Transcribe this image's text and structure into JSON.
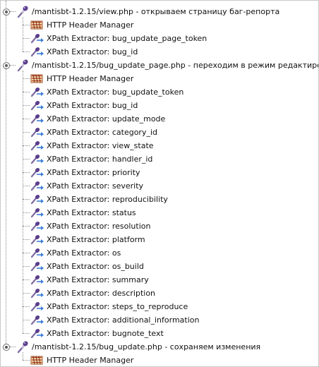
{
  "tree": {
    "groups": [
      {
        "sampler": "/mantisbt-1.2.15/view.php - открываем страницу баг-репорта",
        "children": [
          {
            "icon": "header-manager-icon",
            "label": "HTTP Header Manager"
          },
          {
            "icon": "xpath-extractor-icon",
            "label": "XPath Extractor: bug_update_page_token"
          },
          {
            "icon": "xpath-extractor-icon",
            "label": "XPath Extractor: bug_id"
          }
        ]
      },
      {
        "sampler": "/mantisbt-1.2.15/bug_update_page.php - переходим в режим редактирования",
        "children": [
          {
            "icon": "header-manager-icon",
            "label": "HTTP Header Manager"
          },
          {
            "icon": "xpath-extractor-icon",
            "label": "XPath Extractor: bug_update_token"
          },
          {
            "icon": "xpath-extractor-icon",
            "label": "XPath Extractor: bug_id"
          },
          {
            "icon": "xpath-extractor-icon",
            "label": "XPath Extractor: update_mode"
          },
          {
            "icon": "xpath-extractor-icon",
            "label": "XPath Extractor: category_id"
          },
          {
            "icon": "xpath-extractor-icon",
            "label": "XPath Extractor: view_state"
          },
          {
            "icon": "xpath-extractor-icon",
            "label": "XPath Extractor: handler_id"
          },
          {
            "icon": "xpath-extractor-icon",
            "label": "XPath Extractor: priority"
          },
          {
            "icon": "xpath-extractor-icon",
            "label": "XPath Extractor: severity"
          },
          {
            "icon": "xpath-extractor-icon",
            "label": "XPath Extractor: reproducibility"
          },
          {
            "icon": "xpath-extractor-icon",
            "label": "XPath Extractor: status"
          },
          {
            "icon": "xpath-extractor-icon",
            "label": "XPath Extractor: resolution"
          },
          {
            "icon": "xpath-extractor-icon",
            "label": "XPath Extractor: platform"
          },
          {
            "icon": "xpath-extractor-icon",
            "label": "XPath Extractor: os"
          },
          {
            "icon": "xpath-extractor-icon",
            "label": "XPath Extractor: os_build"
          },
          {
            "icon": "xpath-extractor-icon",
            "label": "XPath Extractor: summary"
          },
          {
            "icon": "xpath-extractor-icon",
            "label": "XPath Extractor: description"
          },
          {
            "icon": "xpath-extractor-icon",
            "label": "XPath Extractor: steps_to_reproduce"
          },
          {
            "icon": "xpath-extractor-icon",
            "label": "XPath Extractor: additional_information"
          },
          {
            "icon": "xpath-extractor-icon",
            "label": "XPath Extractor: bugnote_text"
          }
        ]
      },
      {
        "sampler": "/mantisbt-1.2.15/bug_update.php - сохраняем изменения",
        "children": [
          {
            "icon": "header-manager-icon",
            "label": "HTTP Header Manager"
          }
        ]
      }
    ]
  }
}
